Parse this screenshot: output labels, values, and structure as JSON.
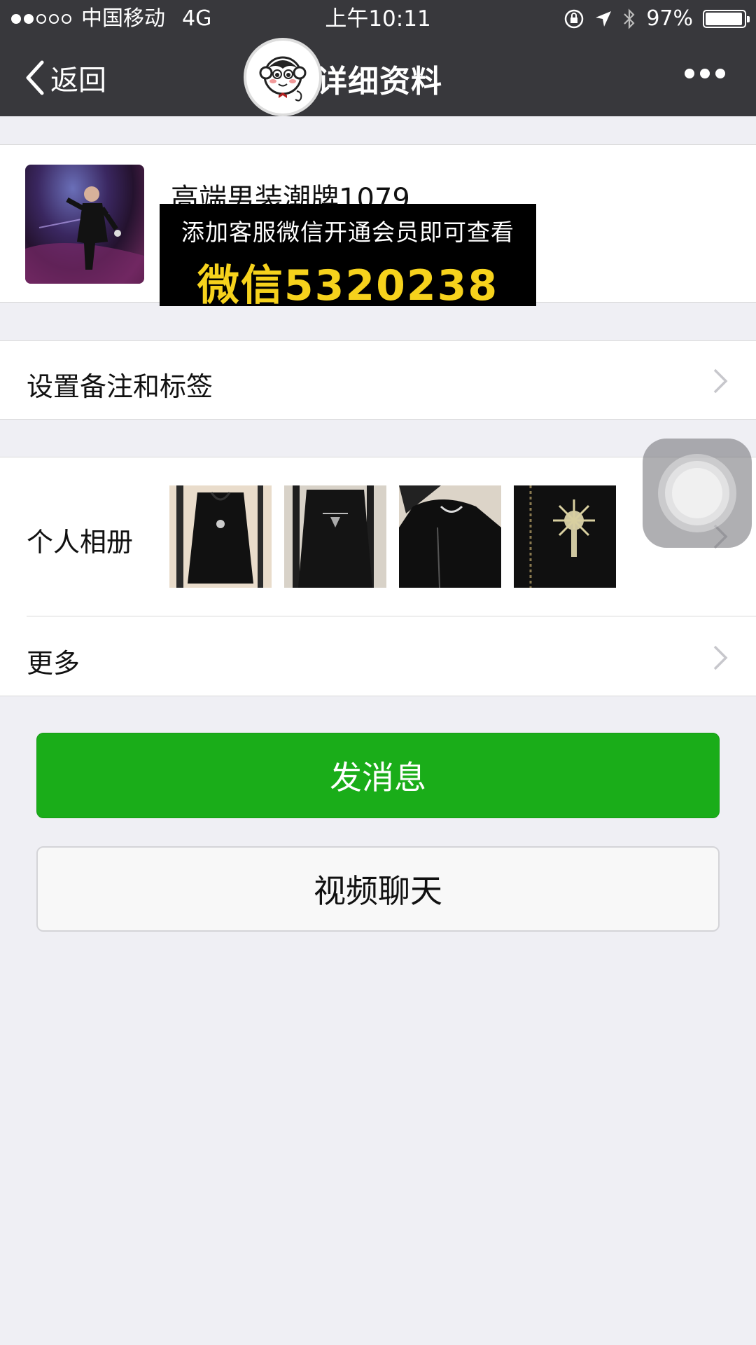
{
  "status_bar": {
    "carrier": "中国移动",
    "network": "4G",
    "time": "上午10:11",
    "battery": "97%",
    "battery_level": 0.97,
    "signal_bars_filled": 2,
    "signal_bars_total": 5
  },
  "nav": {
    "back_label": "返回",
    "title": "详细资料"
  },
  "profile": {
    "name": "高端男装潮牌1079"
  },
  "promo": {
    "line1": "添加客服微信开通会员即可查看",
    "line2": "微信5320238"
  },
  "rows": {
    "remark_label": "设置备注和标签",
    "album_label": "个人相册",
    "more_label": "更多"
  },
  "actions": {
    "send_label": "发消息",
    "video_label": "视频聊天"
  },
  "colors": {
    "nav_bg": "#38383c",
    "accent_green": "#1aad19",
    "promo_yellow": "#f6d21c",
    "page_bg": "#efeff4"
  }
}
